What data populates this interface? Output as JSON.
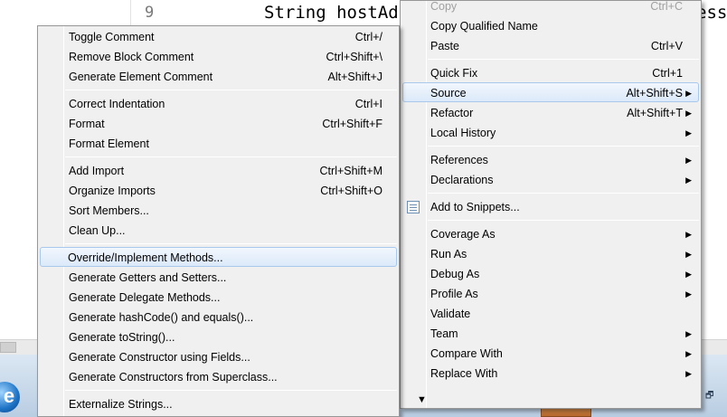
{
  "editor": {
    "line_number": "9",
    "code": "String hostAd",
    "code_tail": "ess"
  },
  "source_menu": {
    "items": [
      {
        "label": "Toggle Comment",
        "accel": "Ctrl+/"
      },
      {
        "label": "Remove Block Comment",
        "accel": "Ctrl+Shift+\\"
      },
      {
        "label": "Generate Element Comment",
        "accel": "Alt+Shift+J"
      },
      {
        "label": "Correct Indentation",
        "accel": "Ctrl+I"
      },
      {
        "label": "Format",
        "accel": "Ctrl+Shift+F"
      },
      {
        "label": "Format Element",
        "accel": ""
      },
      {
        "label": "Add Import",
        "accel": "Ctrl+Shift+M"
      },
      {
        "label": "Organize Imports",
        "accel": "Ctrl+Shift+O"
      },
      {
        "label": "Sort Members...",
        "accel": ""
      },
      {
        "label": "Clean Up...",
        "accel": ""
      },
      {
        "label": "Override/Implement Methods...",
        "accel": ""
      },
      {
        "label": "Generate Getters and Setters...",
        "accel": ""
      },
      {
        "label": "Generate Delegate Methods...",
        "accel": ""
      },
      {
        "label": "Generate hashCode() and equals()...",
        "accel": ""
      },
      {
        "label": "Generate toString()...",
        "accel": ""
      },
      {
        "label": "Generate Constructor using Fields...",
        "accel": ""
      },
      {
        "label": "Generate Constructors from Superclass...",
        "accel": ""
      },
      {
        "label": "Externalize Strings...",
        "accel": ""
      }
    ],
    "highlighted": "Override/Implement Methods..."
  },
  "context_menu": {
    "items": [
      {
        "label": "Copy",
        "accel": "Ctrl+C"
      },
      {
        "label": "Copy Qualified Name",
        "accel": ""
      },
      {
        "label": "Paste",
        "accel": "Ctrl+V"
      },
      {
        "label": "Quick Fix",
        "accel": "Ctrl+1"
      },
      {
        "label": "Source",
        "accel": "Alt+Shift+S"
      },
      {
        "label": "Refactor",
        "accel": "Alt+Shift+T"
      },
      {
        "label": "Local History",
        "accel": ""
      },
      {
        "label": "References",
        "accel": ""
      },
      {
        "label": "Declarations",
        "accel": ""
      },
      {
        "label": "Add to Snippets...",
        "accel": ""
      },
      {
        "label": "Coverage As",
        "accel": ""
      },
      {
        "label": "Run As",
        "accel": ""
      },
      {
        "label": "Debug As",
        "accel": ""
      },
      {
        "label": "Profile As",
        "accel": ""
      },
      {
        "label": "Validate",
        "accel": ""
      },
      {
        "label": "Team",
        "accel": ""
      },
      {
        "label": "Compare With",
        "accel": ""
      },
      {
        "label": "Replace With",
        "accel": ""
      }
    ],
    "highlighted": "Source",
    "submenu_arrow_glyph": "▶",
    "more_glyph": "▼"
  },
  "taskbar": {
    "start_glyph": "e",
    "tray_glyph": "🗗"
  },
  "colors": {
    "menu_bg": "#f0f0f0",
    "highlight_border": "#a8c8ec",
    "disabled_text": "#a0a0a0"
  }
}
